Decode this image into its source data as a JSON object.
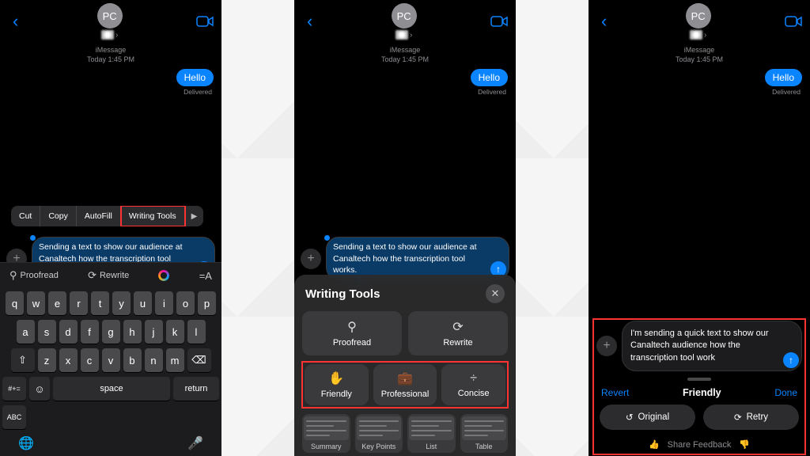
{
  "contact": {
    "initials": "PC"
  },
  "meta": {
    "service": "iMessage",
    "timestamp": "Today 1:45 PM"
  },
  "bubble": {
    "text": "Hello",
    "status": "Delivered"
  },
  "context_menu": {
    "items": [
      "Cut",
      "Copy",
      "AutoFill",
      "Writing Tools"
    ]
  },
  "compose": {
    "draft": "Sending a text to show our audience at Canaltech how the transcription tool works."
  },
  "kb_tools": {
    "proofread": "Proofread",
    "rewrite": "Rewrite"
  },
  "keyboard": {
    "row1": [
      "q",
      "w",
      "e",
      "r",
      "t",
      "y",
      "u",
      "i",
      "o",
      "p"
    ],
    "row2": [
      "a",
      "s",
      "d",
      "f",
      "g",
      "h",
      "j",
      "k",
      "l"
    ],
    "row3": [
      "z",
      "x",
      "c",
      "v",
      "b",
      "n",
      "m"
    ],
    "numkey": "#+=",
    "abc": "ABC",
    "space": "space",
    "ret": "return"
  },
  "writing_tools": {
    "title": "Writing Tools",
    "primary": [
      {
        "label": "Proofread",
        "icon": "search"
      },
      {
        "label": "Rewrite",
        "icon": "compass"
      }
    ],
    "tone": [
      {
        "label": "Friendly",
        "icon": "hand"
      },
      {
        "label": "Professional",
        "icon": "briefcase"
      },
      {
        "label": "Concise",
        "icon": "divide"
      }
    ],
    "formats": [
      "Summary",
      "Key Points",
      "List",
      "Table"
    ]
  },
  "result": {
    "text": "I'm sending a quick text to show our Canaltech audience how the transcription tool work",
    "revert": "Revert",
    "mode": "Friendly",
    "done": "Done",
    "original": "Original",
    "retry": "Retry",
    "feedback": "Share Feedback"
  }
}
